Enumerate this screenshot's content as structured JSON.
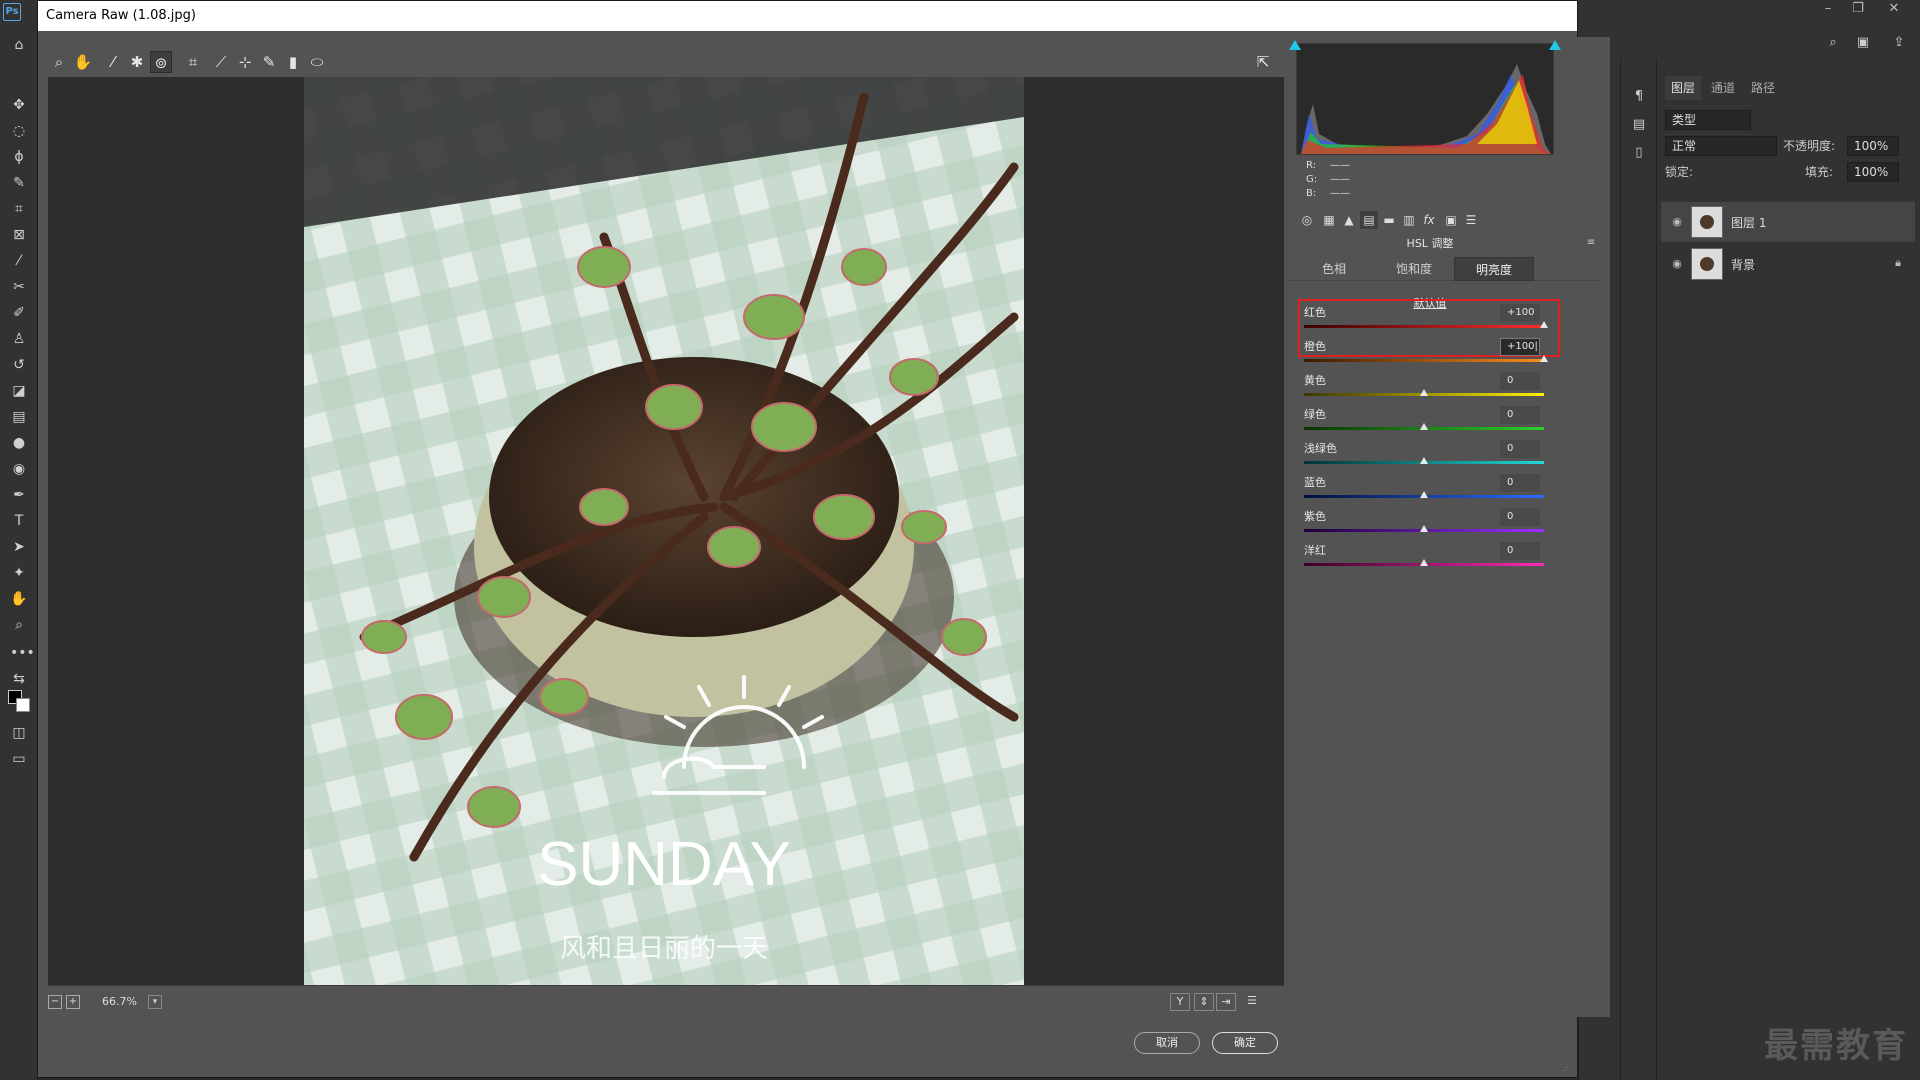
{
  "app": {
    "logo": "Ps",
    "window_controls": [
      "minimize-icon",
      "restore-icon",
      "close-icon"
    ]
  },
  "dialog": {
    "title": "Camera Raw (1.08.jpg)",
    "cancel_label": "取消",
    "ok_label": "确定"
  },
  "toolbar": {
    "tools": [
      "zoom-icon",
      "hand-icon",
      "white-balance-icon",
      "color-sampler-icon",
      "targeted-adjustment-icon",
      "crop-icon",
      "straighten-icon",
      "spot-removal-icon",
      "red-eye-icon",
      "adjustment-brush-icon",
      "graduated-filter-icon",
      "radial-filter-icon"
    ],
    "open_preferences_icon": "preferences-icon"
  },
  "preview": {
    "photo_text_main": "SUNDAY",
    "photo_text_sub": "风和且日丽的一天",
    "zoom": "66.7%"
  },
  "histogram": {
    "rgb_readout": [
      {
        "label": "R:",
        "value": "——"
      },
      {
        "label": "G:",
        "value": "——"
      },
      {
        "label": "B:",
        "value": "——"
      }
    ]
  },
  "panel": {
    "title": "HSL 调整",
    "tabs": [
      "色相",
      "饱和度",
      "明亮度"
    ],
    "active_tab": "明亮度",
    "default_label": "默认值",
    "sliders": [
      {
        "label": "红色",
        "value": "+100",
        "level": 100,
        "gradient": "linear-gradient(90deg,#3a0000,#ff2b2b)"
      },
      {
        "label": "橙色",
        "value": "+100|",
        "level": 100,
        "gradient": "linear-gradient(90deg,#3a1a00,#ff8c1a)"
      },
      {
        "label": "黄色",
        "value": "0",
        "level": 0,
        "gradient": "linear-gradient(90deg,#3b3500,#fff200)"
      },
      {
        "label": "绿色",
        "value": "0",
        "level": 0,
        "gradient": "linear-gradient(90deg,#0a3300,#2bd12b)"
      },
      {
        "label": "浅绿色",
        "value": "0",
        "level": 0,
        "gradient": "linear-gradient(90deg,#003333,#22d6d6)"
      },
      {
        "label": "蓝色",
        "value": "0",
        "level": 0,
        "gradient": "linear-gradient(90deg,#00103a,#2b6bff)"
      },
      {
        "label": "紫色",
        "value": "0",
        "level": 0,
        "gradient": "linear-gradient(90deg,#1c003a,#9b30ff)"
      },
      {
        "label": "洋红",
        "value": "0",
        "level": 0,
        "gradient": "linear-gradient(90deg,#3a0024,#ff2bb4)"
      }
    ]
  },
  "layers": {
    "tabs": [
      "图层",
      "通道",
      "路径"
    ],
    "filter_label": "类型",
    "blend_mode": "正常",
    "opacity_label": "不透明度:",
    "opacity_value": "100%",
    "lock_label": "锁定:",
    "fill_label": "填充:",
    "fill_value": "100%",
    "items": [
      {
        "name": "图层 1",
        "selected": true,
        "locked": false
      },
      {
        "name": "背景",
        "selected": false,
        "locked": true
      }
    ]
  },
  "watermark": "最需教育",
  "colors": {
    "highlight": "#e02020",
    "dialog_bg": "#535353",
    "preview_bg": "#2d2d2d"
  }
}
